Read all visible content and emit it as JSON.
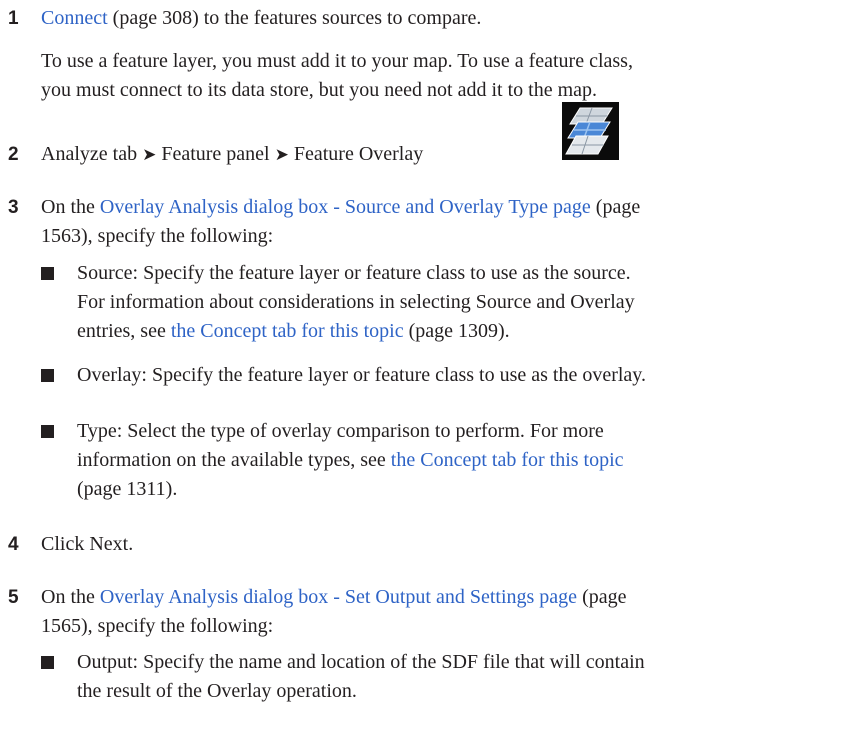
{
  "steps": [
    {
      "number": "1",
      "link": "Connect",
      "after_link": " (page 308) to the features sources to compare.",
      "note_line1": "To use a feature layer, you must add it to your map. To use a feature class,",
      "note_line2": "you must connect to its data store, but you need not add it to the map."
    },
    {
      "number": "2",
      "part1": "Analyze tab",
      "arrow": "➤",
      "part2": "Feature panel",
      "part3": "Feature Overlay",
      "icon": "feature-overlay-icon"
    },
    {
      "number": "3",
      "link": "Overlay Analysis dialog box - Source and Overlay Type page",
      "before_link": "On the ",
      "after_link_l1": " (page",
      "line2": "1563), specify the following:",
      "bullets": [
        {
          "line1": "Source: Specify the feature layer or feature class to use as the source.",
          "line2": "For information about considerations in selecting Source and Overlay",
          "line3_pre": "entries, see ",
          "link": "the Concept tab for this topic",
          "line3_post": " (page 1309)."
        },
        {
          "line1": "Overlay: Specify the feature layer or feature class to use as the overlay."
        },
        {
          "line1": "Type: Select the type of overlay comparison to perform. For more",
          "line2_pre": "information on the available types, see ",
          "link": "the Concept tab for this topic",
          "line3": "(page 1311)."
        }
      ]
    },
    {
      "number": "4",
      "text": "Click Next."
    },
    {
      "number": "5",
      "before_link": "On the ",
      "link": "Overlay Analysis dialog box - Set Output and Settings page",
      "after_link_l1": " (page",
      "line2": "1565), specify the following:",
      "bullets": [
        {
          "line1": "Output: Specify the name and location of the SDF file that will contain",
          "line2": "the result of the Overlay operation."
        }
      ]
    }
  ]
}
